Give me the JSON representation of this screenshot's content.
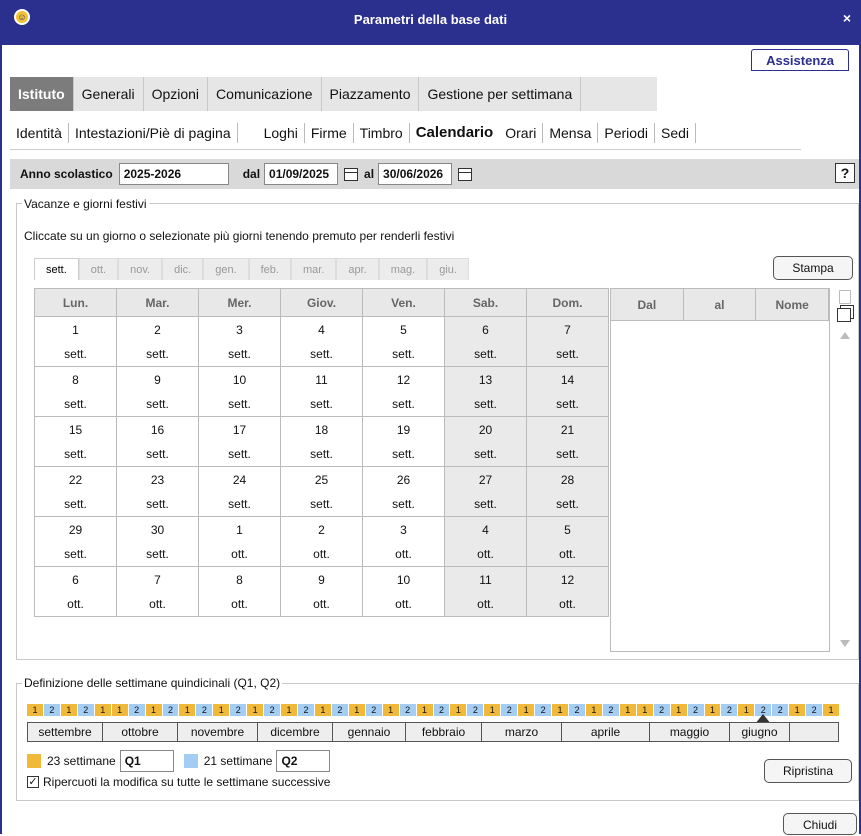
{
  "window": {
    "title": "Parametri della base dati",
    "assist": "Assistenza",
    "close": "×"
  },
  "main_tabs": [
    {
      "label": "Istituto",
      "active": true
    },
    {
      "label": "Generali"
    },
    {
      "label": "Opzioni"
    },
    {
      "label": "Comunicazione"
    },
    {
      "label": "Piazzamento"
    },
    {
      "label": "Gestione per settimana"
    }
  ],
  "sub_tabs": [
    {
      "label": "Identità"
    },
    {
      "label": "Intestazioni/Piè di pagina"
    },
    {
      "label": "Loghi"
    },
    {
      "label": "Firme"
    },
    {
      "label": "Timbro"
    },
    {
      "label": "Calendario",
      "active": true
    },
    {
      "label": "Orari"
    },
    {
      "label": "Mensa"
    },
    {
      "label": "Periodi"
    },
    {
      "label": "Sedi"
    }
  ],
  "year_bar": {
    "label": "Anno scolastico",
    "year": "2025-2026",
    "from_label": "dal",
    "from": "01/09/2025",
    "to_label": "al",
    "to": "30/06/2026",
    "help": "?"
  },
  "holidays": {
    "legend": "Vacanze e giorni festivi",
    "instruction": "Cliccate su un giorno o selezionate più giorni tenendo premuto per renderli festivi",
    "months": [
      "sett.",
      "ott.",
      "nov.",
      "dic.",
      "gen.",
      "feb.",
      "mar.",
      "apr.",
      "mag.",
      "giu."
    ],
    "active_month": 0,
    "print": "Stampa",
    "weekdays": [
      "Lun.",
      "Mar.",
      "Mer.",
      "Giov.",
      "Ven.",
      "Sab.",
      "Dom."
    ],
    "rows": [
      [
        [
          "1",
          "sett."
        ],
        [
          "2",
          "sett."
        ],
        [
          "3",
          "sett."
        ],
        [
          "4",
          "sett."
        ],
        [
          "5",
          "sett."
        ],
        [
          "6",
          "sett."
        ],
        [
          "7",
          "sett."
        ]
      ],
      [
        [
          "8",
          "sett."
        ],
        [
          "9",
          "sett."
        ],
        [
          "10",
          "sett."
        ],
        [
          "11",
          "sett."
        ],
        [
          "12",
          "sett."
        ],
        [
          "13",
          "sett."
        ],
        [
          "14",
          "sett."
        ]
      ],
      [
        [
          "15",
          "sett."
        ],
        [
          "16",
          "sett."
        ],
        [
          "17",
          "sett."
        ],
        [
          "18",
          "sett."
        ],
        [
          "19",
          "sett."
        ],
        [
          "20",
          "sett."
        ],
        [
          "21",
          "sett."
        ]
      ],
      [
        [
          "22",
          "sett."
        ],
        [
          "23",
          "sett."
        ],
        [
          "24",
          "sett."
        ],
        [
          "25",
          "sett."
        ],
        [
          "26",
          "sett."
        ],
        [
          "27",
          "sett."
        ],
        [
          "28",
          "sett."
        ]
      ],
      [
        [
          "29",
          "sett."
        ],
        [
          "30",
          "sett."
        ],
        [
          "1",
          "ott."
        ],
        [
          "2",
          "ott."
        ],
        [
          "3",
          "ott."
        ],
        [
          "4",
          "ott."
        ],
        [
          "5",
          "ott."
        ]
      ],
      [
        [
          "6",
          "ott."
        ],
        [
          "7",
          "ott."
        ],
        [
          "8",
          "ott."
        ],
        [
          "9",
          "ott."
        ],
        [
          "10",
          "ott."
        ],
        [
          "11",
          "ott."
        ],
        [
          "12",
          "ott."
        ]
      ]
    ],
    "list_headers": [
      "Dal",
      "al",
      "Nome"
    ]
  },
  "fortnight": {
    "legend": "Definizione delle settimane quindicinali (Q1, Q2)",
    "weeks": [
      "1",
      "2",
      "1",
      "2",
      "1",
      "1",
      "2",
      "1",
      "2",
      "1",
      "2",
      "1",
      "2",
      "1",
      "2",
      "1",
      "2",
      "1",
      "2",
      "1",
      "2",
      "1",
      "2",
      "1",
      "2",
      "1",
      "2",
      "1",
      "2",
      "1",
      "2",
      "1",
      "2",
      "1",
      "2",
      "1",
      "1",
      "2",
      "1",
      "2",
      "1",
      "2",
      "1",
      "2",
      "2",
      "1",
      "2",
      "1"
    ],
    "months": [
      "settembre",
      "ottobre",
      "novembre",
      "dicembre",
      "gennaio",
      "febbraio",
      "marzo",
      "aprile",
      "maggio",
      "giugno"
    ],
    "q1_count": "23 settimane",
    "q1_name": "Q1",
    "q2_count": "21 settimane",
    "q2_name": "Q2",
    "propagate": "Ripercuoti la modifica su tutte le settimane successive",
    "reset": "Ripristina",
    "colors": {
      "q1": "#f1b93a",
      "q2": "#a4cdf4"
    }
  },
  "close_button": "Chiudi"
}
